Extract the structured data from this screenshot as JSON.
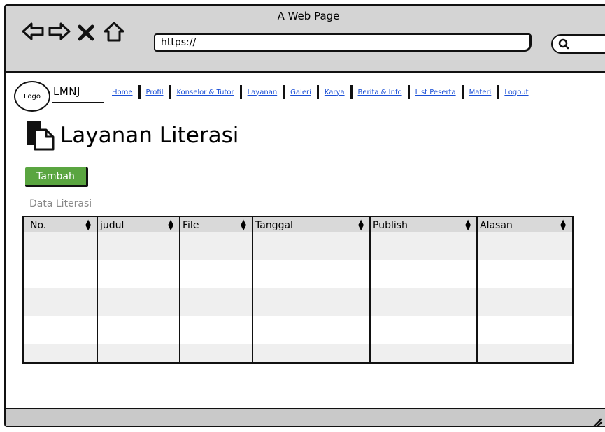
{
  "window": {
    "title": "A Web Page"
  },
  "browser": {
    "url": "https://",
    "search_placeholder": ""
  },
  "site": {
    "logo_text": "Logo",
    "brand": "LMNJ",
    "menu": [
      "Home",
      "Profil",
      "Konselor & Tutor",
      "Layanan",
      "Galeri",
      "Karya",
      "Berita & Info",
      "List Peserta",
      "Materi",
      "Logout"
    ]
  },
  "page": {
    "title": "Layanan Literasi",
    "add_button": "Tambah",
    "section_label": "Data Literasi"
  },
  "table": {
    "columns": [
      "No.",
      "judul",
      "File",
      "Tanggal",
      "Publish",
      "Alasan"
    ],
    "rows": []
  },
  "colors": {
    "accent_button": "#5aa540",
    "link": "#1a4fd6"
  }
}
